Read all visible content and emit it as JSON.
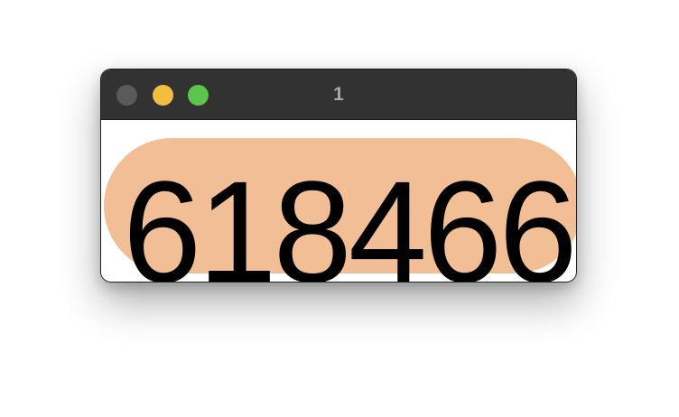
{
  "window": {
    "title": "1",
    "controls": {
      "close_color": "#5a5a5a",
      "minimize_color": "#f5bd3f",
      "zoom_color": "#5cc64b"
    }
  },
  "content": {
    "code": "618466",
    "pill_color": "#f2be95",
    "text_color": "#000000"
  }
}
